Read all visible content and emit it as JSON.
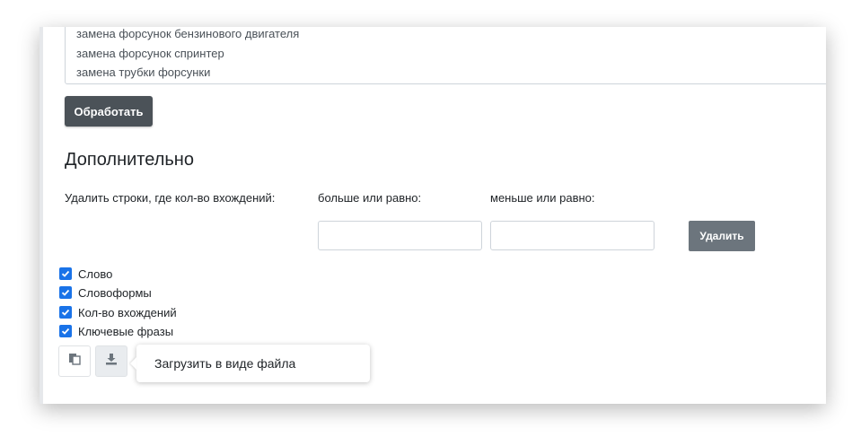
{
  "keywords_textarea": {
    "lines": [
      "замена форсунок бензинового двигателя",
      "замена форсунок спринтер",
      "замена трубки форсунки"
    ]
  },
  "process_button": "Обработать",
  "additional": {
    "title": "Дополнительно",
    "delete_rows_label": "Удалить строки, где кол-во вхождений:",
    "gte_label": "больше или равно:",
    "lte_label": "меньше или равно:",
    "gte_value": "",
    "lte_value": "",
    "delete_button": "Удалить"
  },
  "columns": [
    {
      "label": "Слово",
      "checked": true
    },
    {
      "label": "Словоформы",
      "checked": true
    },
    {
      "label": "Кол-во вхождений",
      "checked": true
    },
    {
      "label": "Ключевые фразы",
      "checked": true
    }
  ],
  "actions": {
    "copy_icon": "copy-icon",
    "download_icon": "download-icon",
    "download_tooltip": "Загрузить в виде файла"
  },
  "colors": {
    "checkbox": "#1a73e8",
    "dark_button": "#4b5258",
    "gray_button": "#6c757d"
  }
}
